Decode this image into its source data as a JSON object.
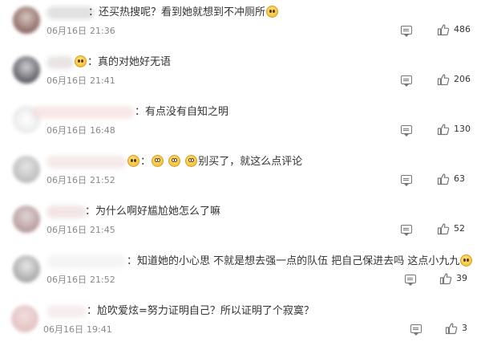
{
  "comments": [
    {
      "text": "还买热搜呢？看到她就想到不冲厕所",
      "emoji_after": [
        "crying-face"
      ],
      "emoji_before": [],
      "date": "06月16日",
      "time": "21:36",
      "likes": "486"
    },
    {
      "text": "真的对她好无语",
      "emoji_after": [],
      "emoji_before": [
        "heart-face"
      ],
      "date": "06月16日",
      "time": "21:41",
      "likes": "206"
    },
    {
      "text": "有点没有自知之明",
      "emoji_after": [],
      "emoji_before": [],
      "date": "06月16日",
      "time": "16:48",
      "likes": "130"
    },
    {
      "text": "别买了，就这么点评论",
      "emoji_after": [],
      "emoji_before": [
        "shocked-face",
        "shocked-face",
        "shocked-face"
      ],
      "date": "06月16日",
      "time": "21:52",
      "likes": "63"
    },
    {
      "text": "为什么啊好尴尬她怎么了嘛",
      "emoji_after": [],
      "emoji_before": [],
      "date": "06月16日",
      "time": "21:45",
      "likes": "52"
    },
    {
      "text": "知道她的小心思 不就是想去强一点的队伍 把自己保进去吗 这点小九九",
      "emoji_after": [
        "sweat-face"
      ],
      "emoji_before": [],
      "date": "06月16日",
      "time": "21:52",
      "likes": "39"
    },
    {
      "text": "尬吹爱炫=努力证明自己？所以证明了个寂寞？",
      "emoji_after": [],
      "emoji_before": [],
      "date": "06月16日",
      "time": "19:41",
      "likes": "3"
    }
  ],
  "icons": {
    "reply": "comment-icon",
    "like": "thumbs-up-icon"
  },
  "colors": {
    "text": "#333333",
    "meta": "#888888",
    "icon": "#777777"
  }
}
